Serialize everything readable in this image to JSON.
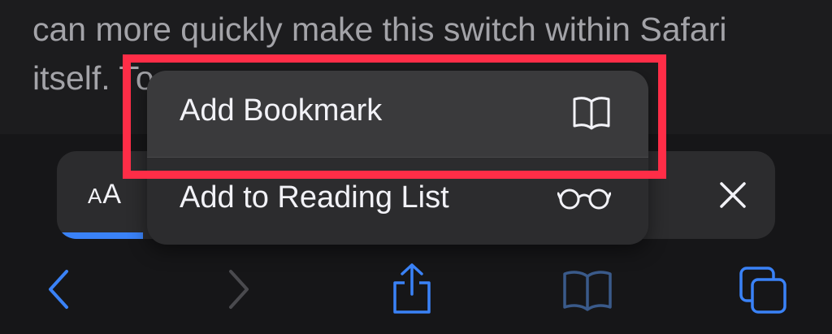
{
  "article": {
    "text": "can more quickly make this switch within Safari itself. To"
  },
  "url_bar": {
    "aa_large": "A",
    "aa_small": "A",
    "progress_percent": 12
  },
  "menu": {
    "items": [
      {
        "label": "Add Bookmark",
        "icon": "book-icon"
      },
      {
        "label": "Add to Reading List",
        "icon": "glasses-icon"
      }
    ]
  },
  "toolbar": {
    "icons": [
      "back-icon",
      "forward-icon",
      "share-icon",
      "bookmarks-icon",
      "tabs-icon"
    ]
  },
  "colors": {
    "accent": "#3a82f7",
    "highlight": "#ff2d47",
    "menu_bg": "#2c2c2e"
  }
}
